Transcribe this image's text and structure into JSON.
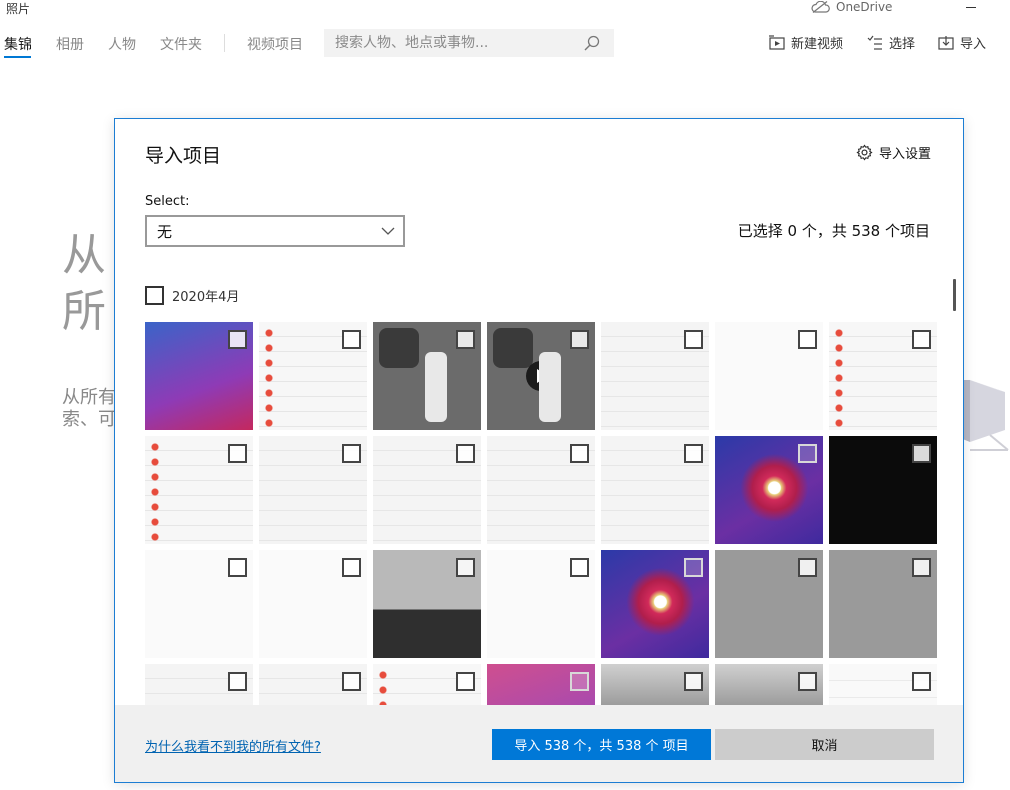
{
  "app": {
    "title": "照片",
    "onedrive_label": "OneDrive"
  },
  "nav": {
    "tabs": [
      {
        "label": "集锦",
        "active": true
      },
      {
        "label": "相册",
        "active": false
      },
      {
        "label": "人物",
        "active": false
      },
      {
        "label": "文件夹",
        "active": false
      },
      {
        "label": "视频项目",
        "active": false
      }
    ],
    "search_placeholder": "搜索人物、地点或事物...",
    "toolbar": {
      "new_video": "新建视频",
      "select": "选择",
      "import": "导入"
    }
  },
  "background": {
    "heading_line1": "从",
    "heading_line2": "所",
    "body_line1": "从所有",
    "body_line2": "索、可"
  },
  "dialog": {
    "title": "导入项目",
    "settings_label": "导入设置",
    "select_label": "Select:",
    "select_value": "无",
    "count_text": "已选择 0 个，共 538 个项目",
    "group_label": "2020年4月",
    "help_link": "为什么我看不到我的所有文件?",
    "import_button": "导入 538 个，共 538 个 项目",
    "cancel_button": "取消"
  },
  "colors": {
    "accent": "#0078d7",
    "dialog_border": "#1c7dd3",
    "link": "#0063b1"
  },
  "thumbnails": [
    {
      "style": "home",
      "checkbox": "dark"
    },
    {
      "style": "settings-dots",
      "checkbox": "dark"
    },
    {
      "style": "control",
      "checkbox": "dark"
    },
    {
      "style": "control-video",
      "checkbox": "dark"
    },
    {
      "style": "settings",
      "checkbox": "dark"
    },
    {
      "style": "white",
      "checkbox": "dark"
    },
    {
      "style": "settings-dots",
      "checkbox": "dark"
    },
    {
      "style": "settings-dots",
      "checkbox": "dark"
    },
    {
      "style": "settings",
      "checkbox": "dark"
    },
    {
      "style": "settings",
      "checkbox": "dark"
    },
    {
      "style": "settings",
      "checkbox": "dark"
    },
    {
      "style": "settings",
      "checkbox": "dark"
    },
    {
      "style": "flower",
      "checkbox": "light"
    },
    {
      "style": "black",
      "checkbox": "dark"
    },
    {
      "style": "white",
      "checkbox": "dark"
    },
    {
      "style": "white",
      "checkbox": "dark"
    },
    {
      "style": "keyboard",
      "checkbox": "dark"
    },
    {
      "style": "white",
      "checkbox": "dark"
    },
    {
      "style": "flower",
      "checkbox": "light"
    },
    {
      "style": "gray",
      "checkbox": "dark"
    },
    {
      "style": "gray",
      "checkbox": "dark"
    },
    {
      "style": "settings",
      "checkbox": "dark"
    },
    {
      "style": "settings",
      "checkbox": "dark"
    },
    {
      "style": "settings-dots",
      "checkbox": "dark"
    },
    {
      "style": "pink",
      "checkbox": "light"
    },
    {
      "style": "blur",
      "checkbox": "dark"
    },
    {
      "style": "blur",
      "checkbox": "dark"
    },
    {
      "style": "wechat",
      "checkbox": "dark"
    }
  ]
}
